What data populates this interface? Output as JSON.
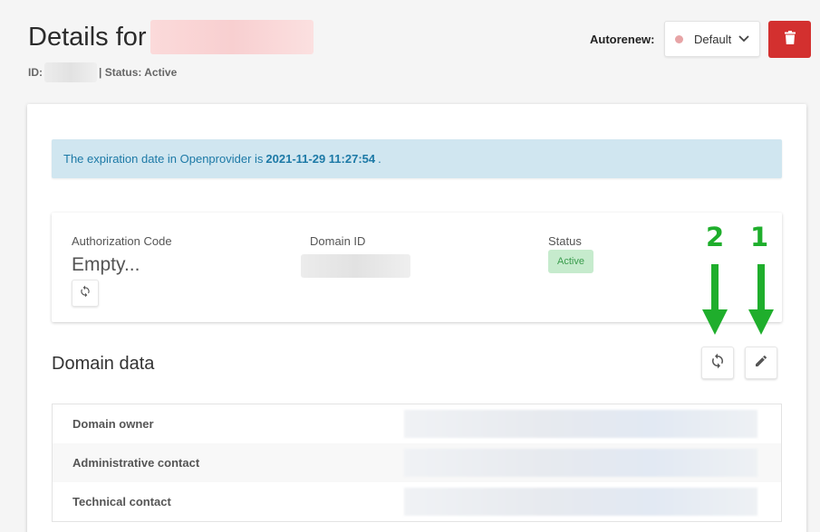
{
  "header": {
    "title_prefix": "Details for",
    "id_label": "ID:",
    "status_text": "| Status: Active"
  },
  "autorenew": {
    "label": "Autorenew:",
    "selected": "Default",
    "dot_color": "#e7a4a6"
  },
  "delete_button": {
    "icon": "trash-icon",
    "color": "#d3302f"
  },
  "alert": {
    "text_before": "The expiration date in Openprovider is",
    "date": "2021-11-29 11:27:54",
    "text_after": "."
  },
  "info": {
    "auth_label": "Authorization Code",
    "auth_value": "Empty...",
    "domain_id_label": "Domain ID",
    "status_label": "Status",
    "status_value": "Active"
  },
  "annotations": {
    "marker_1": "1",
    "marker_2": "2",
    "color": "#1fae2c"
  },
  "domain_data": {
    "title": "Domain data",
    "rows": [
      {
        "label": "Domain owner"
      },
      {
        "label": "Administrative contact"
      },
      {
        "label": "Technical contact"
      }
    ]
  }
}
